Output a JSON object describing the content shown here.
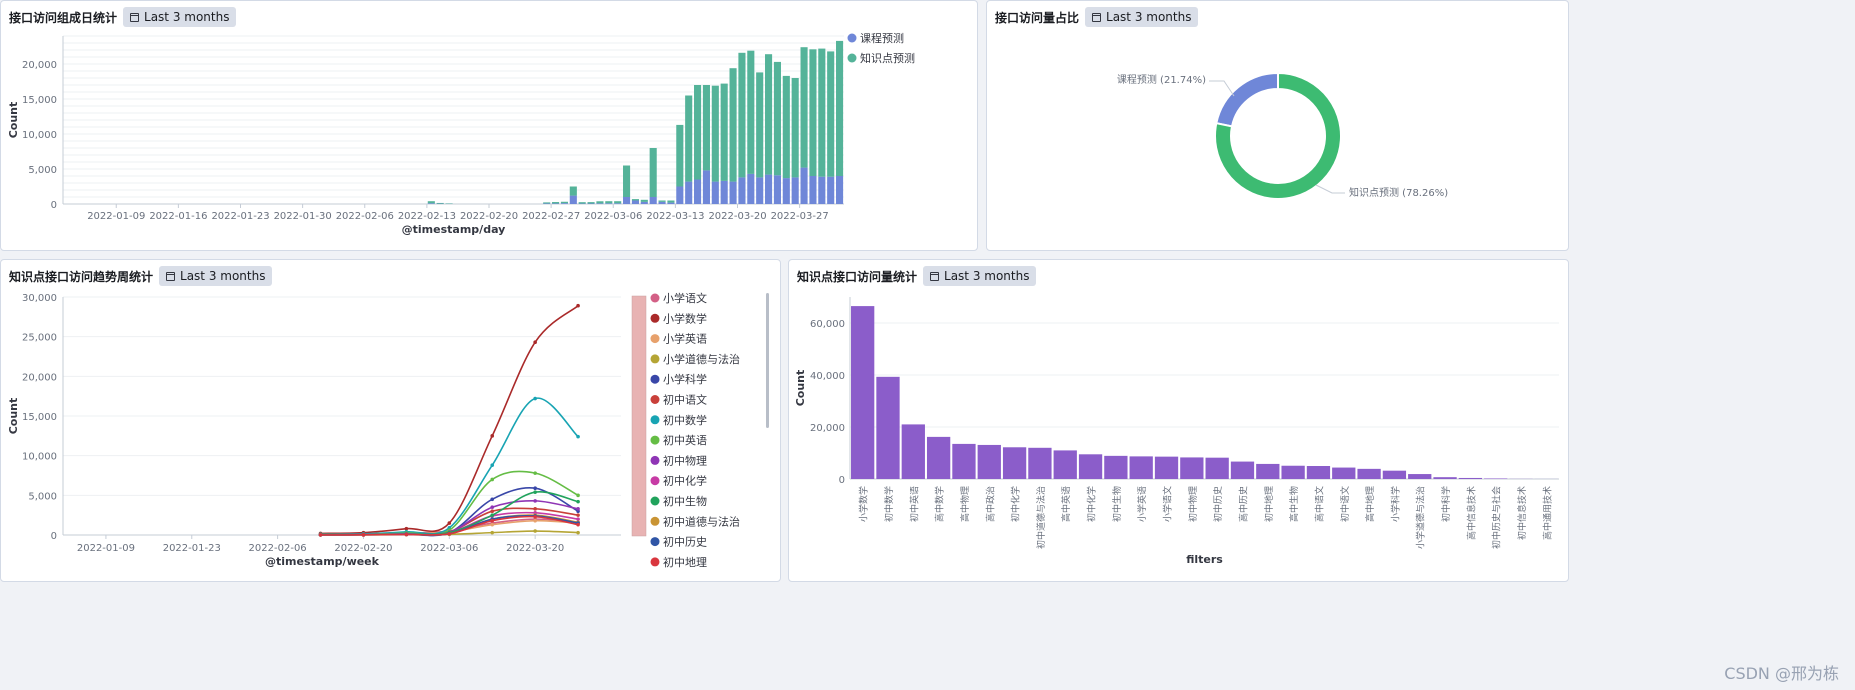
{
  "panels": {
    "p1": {
      "title": "接口访问组成日统计",
      "time": "Last 3 months"
    },
    "p2": {
      "title": "接口访问量占比",
      "time": "Last 3 months"
    },
    "p3": {
      "title": "知识点接口访问趋势周统计",
      "time": "Last 3 months"
    },
    "p4": {
      "title": "知识点接口访问量统计",
      "time": "Last 3 months"
    }
  },
  "watermark": "CSDN @邢为栋",
  "colors": {
    "course": "#6f87d8",
    "knowledge": "#54b399",
    "pie_course": "#6f87d8",
    "pie_know": "#3dbb72",
    "bar4": "#8b5dca",
    "scroll_red": "#e8b3b3"
  },
  "chart_data": [
    {
      "type": "bar",
      "stacked": true,
      "xlabel": "@timestamp/day",
      "ylabel": "Count",
      "ylim": [
        0,
        24000
      ],
      "yticks": [
        0,
        5000,
        10000,
        15000,
        20000
      ],
      "ytick_labels": [
        "0",
        "5,000",
        "10,000",
        "15,000",
        "20,000"
      ],
      "xtick_labels": [
        "2022-01-09",
        "2022-01-16",
        "2022-01-23",
        "2022-01-30",
        "2022-02-06",
        "2022-02-13",
        "2022-02-20",
        "2022-02-27",
        "2022-03-06",
        "2022-03-13",
        "2022-03-20",
        "2022-03-27"
      ],
      "legend": [
        "课程预测",
        "知识点预测"
      ],
      "legend_position": "top-right",
      "categories": [
        "2022-02-13",
        "2022-02-14",
        "2022-02-15",
        "2022-02-26",
        "2022-02-27",
        "2022-02-28",
        "2022-03-01",
        "2022-03-02",
        "2022-03-03",
        "2022-03-04",
        "2022-03-05",
        "2022-03-06",
        "2022-03-07",
        "2022-03-08",
        "2022-03-09",
        "2022-03-10",
        "2022-03-11",
        "2022-03-12",
        "2022-03-13",
        "2022-03-14",
        "2022-03-15",
        "2022-03-16",
        "2022-03-17",
        "2022-03-18",
        "2022-03-19",
        "2022-03-20",
        "2022-03-21",
        "2022-03-22",
        "2022-03-23",
        "2022-03-24",
        "2022-03-25",
        "2022-03-26",
        "2022-03-27",
        "2022-03-28",
        "2022-03-29",
        "2022-03-30",
        "2022-03-31"
      ],
      "series": [
        {
          "name": "课程预测",
          "values": [
            100,
            50,
            30,
            80,
            80,
            120,
            1200,
            60,
            70,
            90,
            100,
            100,
            1000,
            500,
            300,
            1000,
            300,
            200,
            2500,
            3200,
            3500,
            4800,
            3200,
            3300,
            3200,
            3800,
            4300,
            3800,
            4200,
            4100,
            3700,
            3800,
            5200,
            4000,
            3900,
            3900,
            4000
          ]
        },
        {
          "name": "知识点预测",
          "values": [
            300,
            100,
            60,
            150,
            200,
            200,
            1300,
            200,
            200,
            300,
            300,
            300,
            4500,
            200,
            300,
            7000,
            200,
            300,
            8800,
            12300,
            13500,
            12200,
            13700,
            13900,
            16200,
            17800,
            17600,
            15000,
            17200,
            16200,
            14600,
            14200,
            17200,
            18100,
            18300,
            17900,
            19300
          ]
        }
      ]
    },
    {
      "type": "pie",
      "donut": true,
      "labels": [
        "课程预测 (21.74%)",
        "知识点预测 (78.26%)"
      ],
      "categories": [
        "课程预测",
        "知识点预测"
      ],
      "values": [
        21.74,
        78.26
      ]
    },
    {
      "type": "line",
      "xlabel": "@timestamp/week",
      "ylabel": "Count",
      "ylim": [
        0,
        30000
      ],
      "yticks": [
        0,
        5000,
        10000,
        15000,
        20000,
        25000,
        30000
      ],
      "ytick_labels": [
        "0",
        "5,000",
        "10,000",
        "15,000",
        "20,000",
        "25,000",
        "30,000"
      ],
      "xtick_labels": [
        "2022-01-09",
        "2022-01-23",
        "2022-02-06",
        "2022-02-20",
        "2022-03-06",
        "2022-03-20"
      ],
      "x": [
        "2022-02-13",
        "2022-02-20",
        "2022-02-27",
        "2022-03-06",
        "2022-03-13",
        "2022-03-20",
        "2022-03-27"
      ],
      "legend_position": "right",
      "series": [
        {
          "name": "小学语文",
          "color": "#d36086",
          "values": [
            50,
            80,
            200,
            500,
            1500,
            2000,
            1600
          ]
        },
        {
          "name": "小学数学",
          "color": "#aa2a2a",
          "values": [
            200,
            300,
            800,
            1500,
            12500,
            24300,
            28900
          ]
        },
        {
          "name": "小学英语",
          "color": "#e7a16c",
          "values": [
            40,
            60,
            150,
            400,
            1300,
            1800,
            1500
          ]
        },
        {
          "name": "小学道德与法治",
          "color": "#b5a535",
          "values": [
            10,
            20,
            40,
            80,
            300,
            500,
            300
          ]
        },
        {
          "name": "小学科学",
          "color": "#3947a8",
          "values": [
            30,
            50,
            120,
            300,
            4500,
            5900,
            3000
          ]
        },
        {
          "name": "初中语文",
          "color": "#c9403a",
          "values": [
            40,
            60,
            150,
            400,
            3000,
            3300,
            2500
          ]
        },
        {
          "name": "初中数学",
          "color": "#18a4b3",
          "values": [
            100,
            150,
            400,
            900,
            8800,
            17200,
            12400
          ]
        },
        {
          "name": "初中英语",
          "color": "#65bd45",
          "values": [
            50,
            80,
            250,
            600,
            7000,
            7800,
            5000
          ]
        },
        {
          "name": "初中物理",
          "color": "#8f35b5",
          "values": [
            30,
            50,
            150,
            350,
            3500,
            4300,
            3300
          ]
        },
        {
          "name": "初中化学",
          "color": "#c73ba5",
          "values": [
            20,
            40,
            100,
            300,
            2400,
            2800,
            2000
          ]
        },
        {
          "name": "初中生物",
          "color": "#21a35c",
          "values": [
            20,
            40,
            100,
            300,
            2500,
            5400,
            4200
          ]
        },
        {
          "name": "初中道德与法治",
          "color": "#c99434",
          "values": [
            10,
            20,
            60,
            150,
            2000,
            2500,
            1600
          ]
        },
        {
          "name": "初中历史",
          "color": "#3055a6",
          "values": [
            10,
            20,
            60,
            150,
            2000,
            2400,
            1500
          ]
        },
        {
          "name": "初中地理",
          "color": "#d9363e",
          "values": [
            10,
            20,
            60,
            150,
            1800,
            2300,
            1300
          ]
        }
      ]
    },
    {
      "type": "bar",
      "xlabel": "filters",
      "ylabel": "Count",
      "ylim": [
        0,
        70000
      ],
      "yticks": [
        0,
        20000,
        40000,
        60000
      ],
      "ytick_labels": [
        "0",
        "20,000",
        "40,000",
        "60,000"
      ],
      "categories": [
        "小学数学",
        "初中数学",
        "初中英语",
        "高中数学",
        "高中物理",
        "高中政治",
        "初中化学",
        "初中道德与法治",
        "高中英语",
        "初中化学",
        "初中生物",
        "小学英语",
        "小学语文",
        "初中物理",
        "初中历史",
        "高中历史",
        "初中地理",
        "高中生物",
        "高中语文",
        "初中语文",
        "高中地理",
        "小学科学",
        "小学道德与法治",
        "初中科学",
        "高中信息技术",
        "初中历史与社会",
        "初中信息技术",
        "高中通用技术"
      ],
      "values": [
        66500,
        39300,
        21000,
        16200,
        13500,
        13100,
        12200,
        12000,
        11000,
        9500,
        8900,
        8700,
        8600,
        8300,
        8200,
        6700,
        5800,
        5100,
        5000,
        4400,
        3900,
        3200,
        1900,
        700,
        400,
        200,
        50,
        20
      ]
    }
  ]
}
